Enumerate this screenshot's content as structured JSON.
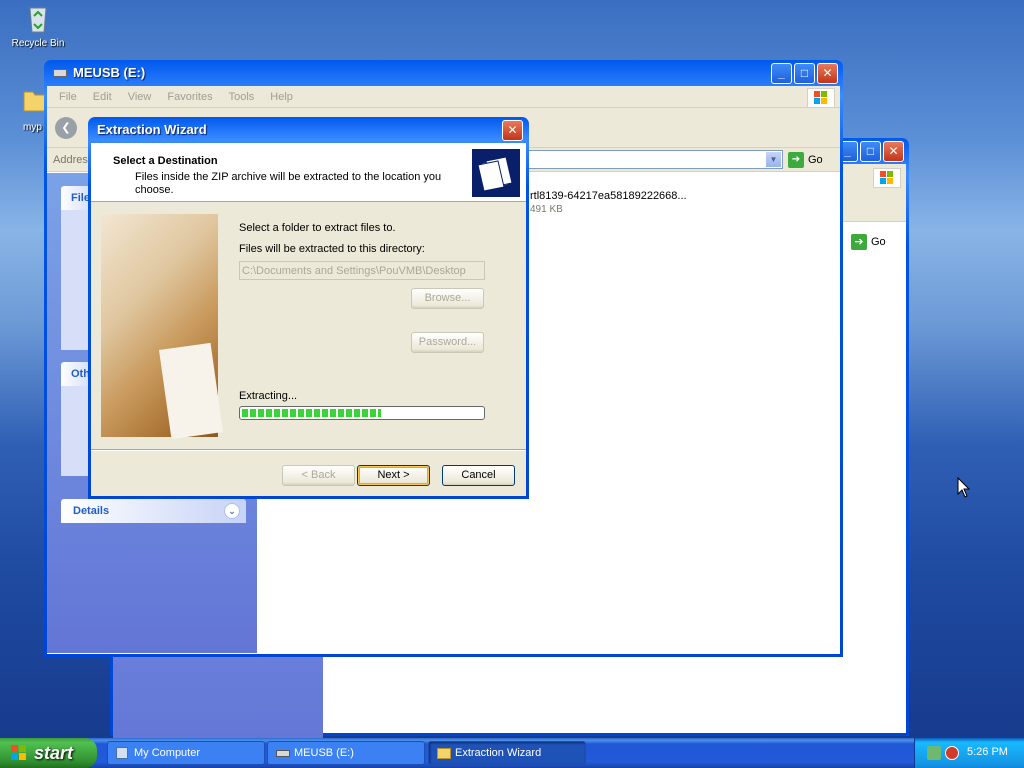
{
  "desktop": {
    "recycle_bin_label": "Recycle Bin",
    "folder_label": "myp"
  },
  "explorer_back": {
    "address_label": "Addres",
    "go_label": "Go"
  },
  "explorer_main": {
    "title": "MEUSB (E:)",
    "menu": [
      "File",
      "Edit",
      "View",
      "Favorites",
      "Tools",
      "Help"
    ],
    "address_label": "Addres",
    "go_label": "Go",
    "file_name": "rtl8139-64217ea58189222668...",
    "file_size": "491 KB",
    "panel_file_title": "File",
    "panel_other_title": "Oth",
    "panel_details_title": "Details"
  },
  "wizard": {
    "title": "Extraction Wizard",
    "header_title": "Select a Destination",
    "header_subtitle_1": "Files inside the ZIP archive will be extracted to the location you",
    "header_subtitle_2": "choose.",
    "select_folder_text": "Select a folder to extract files to.",
    "directory_label": "Files will be extracted to this directory:",
    "directory_value": "C:\\Documents and Settings\\PouVMB\\Desktop",
    "browse_label": "Browse...",
    "password_label": "Password...",
    "extracting_label": "Extracting...",
    "progress": 0.58,
    "back_label": "< Back",
    "next_label": "Next >",
    "cancel_label": "Cancel"
  },
  "taskbar": {
    "start_label": "start",
    "tasks": [
      "My Computer",
      "MEUSB (E:)",
      "Extraction Wizard"
    ],
    "clock": "5:26 PM"
  }
}
